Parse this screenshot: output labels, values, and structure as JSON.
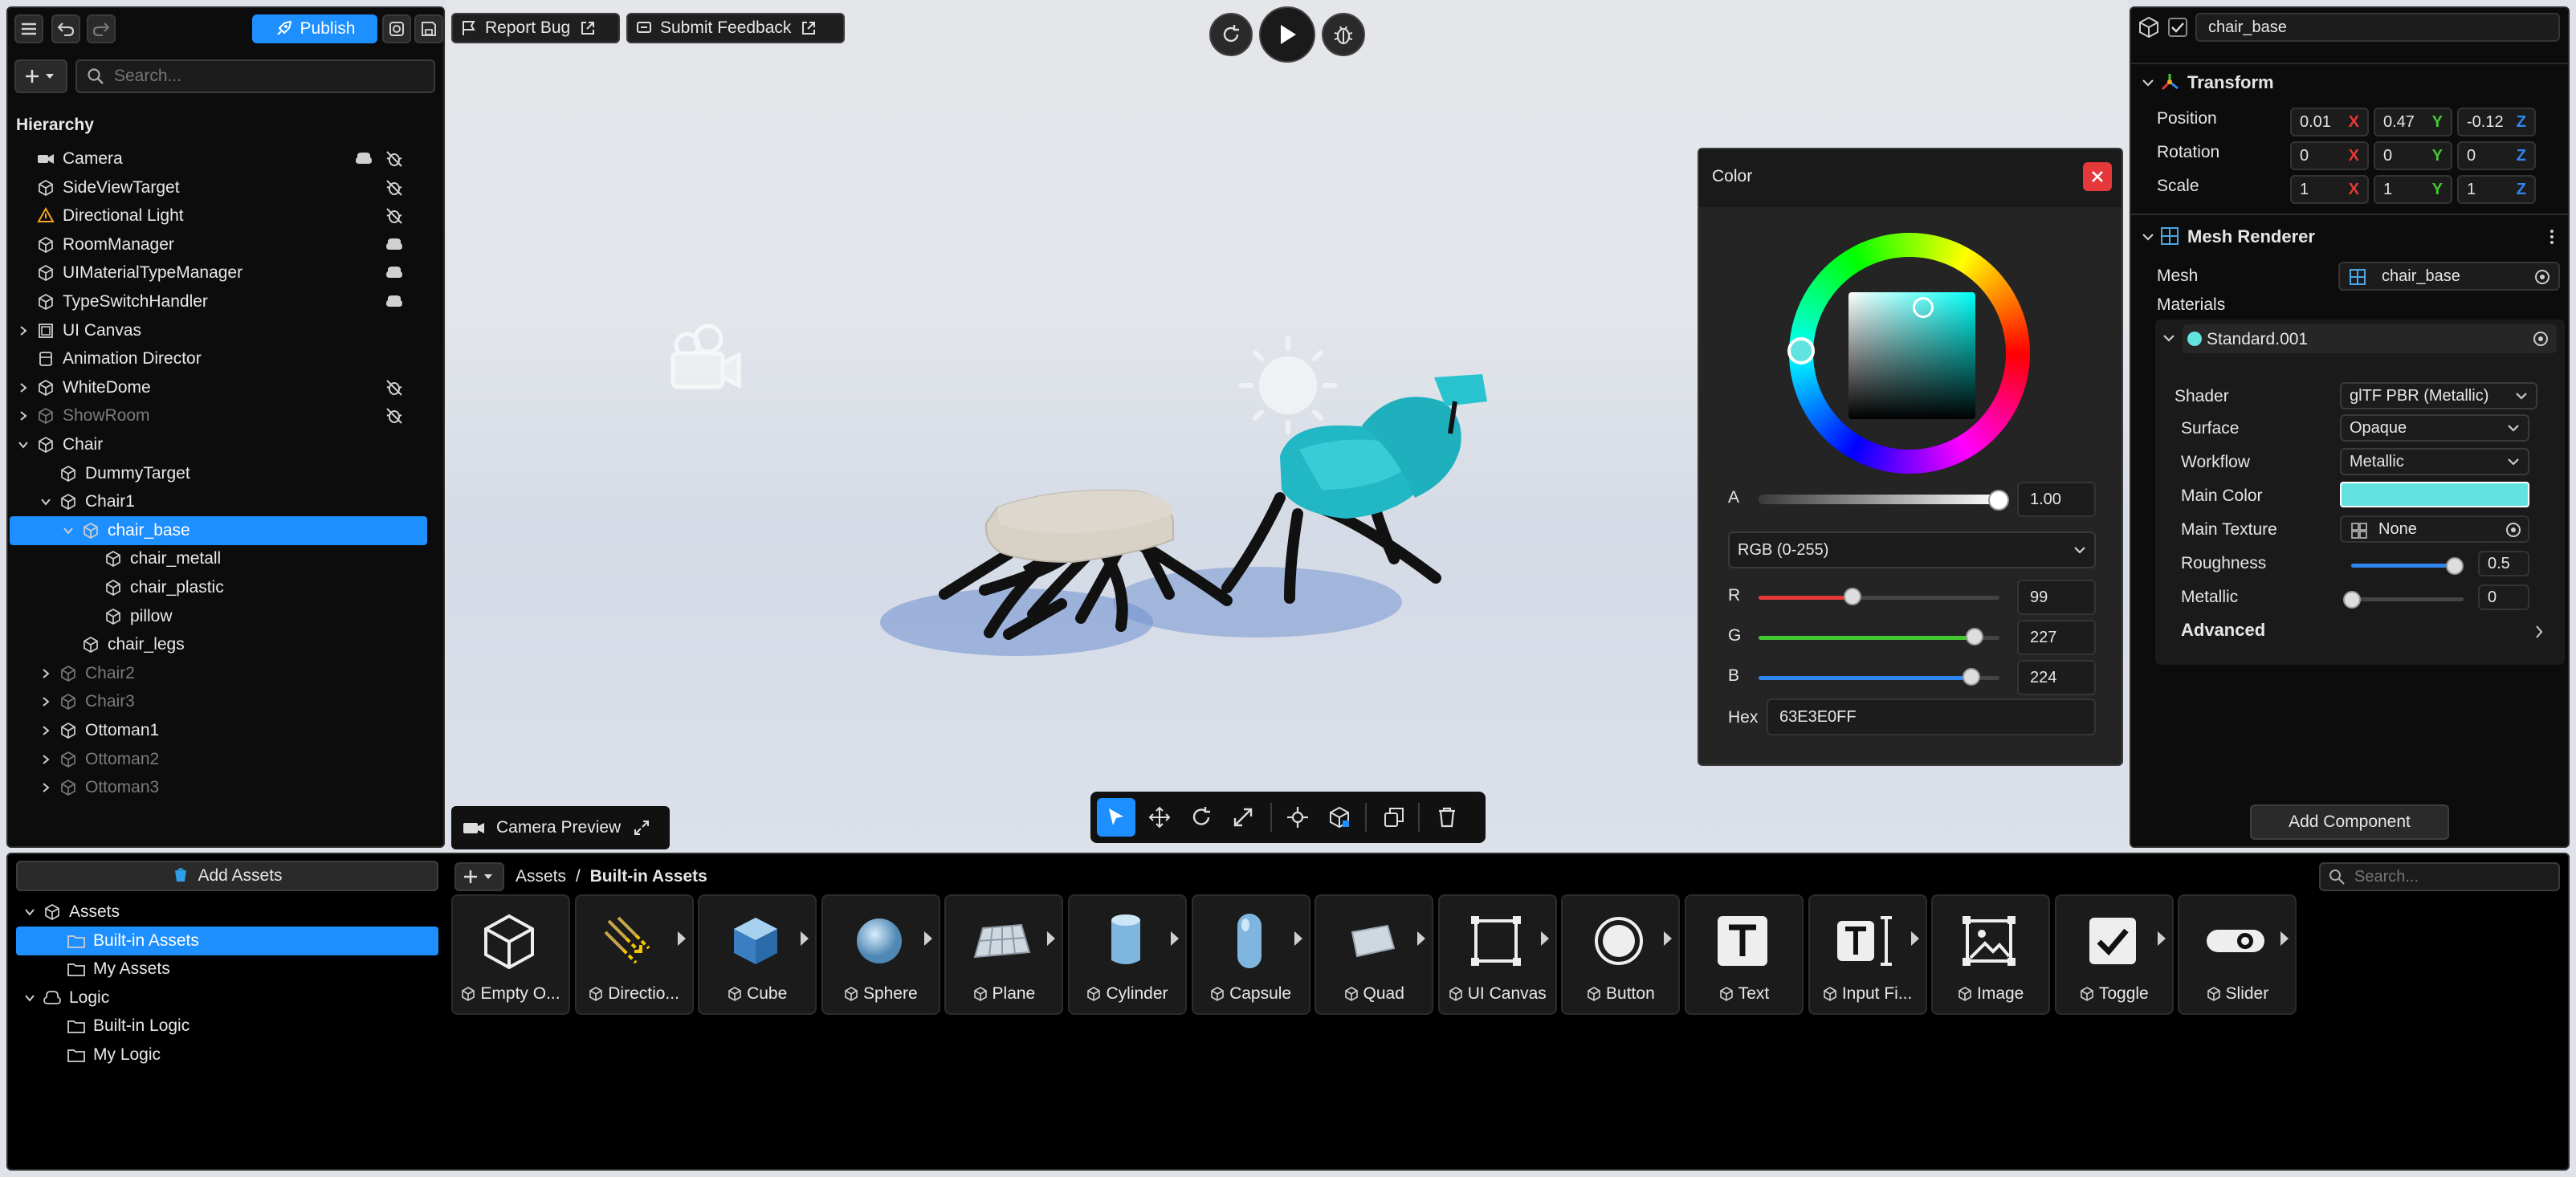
{
  "toolbar": {
    "publish_label": "Publish",
    "report_bug_label": "Report Bug",
    "submit_feedback_label": "Submit Feedback"
  },
  "hierarchy": {
    "search_placeholder": "Search...",
    "title": "Hierarchy",
    "items": [
      {
        "label": "Camera",
        "depth": 0,
        "expand": "none",
        "icon": "camera-icon",
        "dim": false,
        "badges": [
          "script-icon",
          "visibility-off-icon"
        ]
      },
      {
        "label": "SideViewTarget",
        "depth": 0,
        "expand": "none",
        "icon": "cube-icon",
        "dim": false,
        "badges": [
          "visibility-off-icon"
        ]
      },
      {
        "label": "Directional Light",
        "depth": 0,
        "expand": "none",
        "icon": "light-icon",
        "dim": false,
        "badges": [
          "visibility-off-icon"
        ]
      },
      {
        "label": "RoomManager",
        "depth": 0,
        "expand": "none",
        "icon": "cube-icon",
        "dim": false,
        "badges": [
          "script-icon"
        ]
      },
      {
        "label": "UIMaterialTypeManager",
        "depth": 0,
        "expand": "none",
        "icon": "cube-icon",
        "dim": false,
        "badges": [
          "script-icon"
        ]
      },
      {
        "label": "TypeSwitchHandler",
        "depth": 0,
        "expand": "none",
        "icon": "cube-icon",
        "dim": false,
        "badges": [
          "script-icon"
        ]
      },
      {
        "label": "UI Canvas",
        "depth": 0,
        "expand": "collapsed",
        "icon": "canvas-icon",
        "dim": false,
        "badges": []
      },
      {
        "label": "Animation Director",
        "depth": 0,
        "expand": "none",
        "icon": "animation-icon",
        "dim": false,
        "badges": []
      },
      {
        "label": "WhiteDome",
        "depth": 0,
        "expand": "collapsed",
        "icon": "cube-icon",
        "dim": false,
        "badges": [
          "visibility-off-icon"
        ]
      },
      {
        "label": "ShowRoom",
        "depth": 0,
        "expand": "collapsed",
        "icon": "cube-icon",
        "dim": true,
        "badges": [
          "visibility-off-icon"
        ]
      },
      {
        "label": "Chair",
        "depth": 0,
        "expand": "expanded",
        "icon": "cube-icon",
        "dim": false,
        "badges": []
      },
      {
        "label": "DummyTarget",
        "depth": 1,
        "expand": "none",
        "icon": "cube-icon",
        "dim": false,
        "badges": []
      },
      {
        "label": "Chair1",
        "depth": 1,
        "expand": "expanded",
        "icon": "cube-icon",
        "dim": false,
        "badges": []
      },
      {
        "label": "chair_base",
        "depth": 2,
        "expand": "expanded",
        "icon": "cube-icon",
        "dim": false,
        "badges": [],
        "selected": true
      },
      {
        "label": "chair_metall",
        "depth": 3,
        "expand": "none",
        "icon": "cube-icon",
        "dim": false,
        "badges": []
      },
      {
        "label": "chair_plastic",
        "depth": 3,
        "expand": "none",
        "icon": "cube-icon",
        "dim": false,
        "badges": []
      },
      {
        "label": "pillow",
        "depth": 3,
        "expand": "none",
        "icon": "cube-icon",
        "dim": false,
        "badges": []
      },
      {
        "label": "chair_legs",
        "depth": 2,
        "expand": "none",
        "icon": "cube-icon",
        "dim": false,
        "badges": []
      },
      {
        "label": "Chair2",
        "depth": 1,
        "expand": "collapsed",
        "icon": "cube-icon",
        "dim": true,
        "badges": []
      },
      {
        "label": "Chair3",
        "depth": 1,
        "expand": "collapsed",
        "icon": "cube-icon",
        "dim": true,
        "badges": []
      },
      {
        "label": "Ottoman1",
        "depth": 1,
        "expand": "collapsed",
        "icon": "cube-icon",
        "dim": false,
        "badges": []
      },
      {
        "label": "Ottoman2",
        "depth": 1,
        "expand": "collapsed",
        "icon": "cube-icon",
        "dim": true,
        "badges": []
      },
      {
        "label": "Ottoman3",
        "depth": 1,
        "expand": "collapsed",
        "icon": "cube-icon",
        "dim": true,
        "badges": []
      }
    ]
  },
  "viewport": {
    "camera_preview_label": "Camera Preview"
  },
  "color_picker": {
    "title": "Color",
    "alpha_label": "A",
    "alpha_value": "1.00",
    "mode_label": "RGB (0-255)",
    "r_label": "R",
    "r_value": "99",
    "g_label": "G",
    "g_value": "227",
    "b_label": "B",
    "b_value": "224",
    "hex_label": "Hex",
    "hex_value": "63E3E0FF",
    "color": "#63e3e0"
  },
  "inspector": {
    "object_name": "chair_base",
    "transform": {
      "title": "Transform",
      "position_label": "Position",
      "rotation_label": "Rotation",
      "scale_label": "Scale",
      "position": [
        "0.01",
        "0.47",
        "-0.12"
      ],
      "rotation": [
        "0",
        "0",
        "0"
      ],
      "scale": [
        "1",
        "1",
        "1"
      ],
      "axes": [
        "X",
        "Y",
        "Z"
      ]
    },
    "mesh_renderer": {
      "title": "Mesh Renderer",
      "mesh_label": "Mesh",
      "mesh_value": "chair_base",
      "materials_label": "Materials",
      "material_name": "Standard.001",
      "shader_label": "Shader",
      "shader_value": "glTF PBR (Metallic)",
      "surface_label": "Surface",
      "surface_value": "Opaque",
      "workflow_label": "Workflow",
      "workflow_value": "Metallic",
      "main_color_label": "Main Color",
      "main_texture_label": "Main Texture",
      "main_texture_value": "None",
      "roughness_label": "Roughness",
      "roughness_value": "0.5",
      "metallic_label": "Metallic",
      "metallic_value": "0",
      "advanced_label": "Advanced"
    },
    "add_component_label": "Add Component"
  },
  "assets_panel": {
    "add_assets_label": "Add Assets",
    "tree": [
      {
        "label": "Assets",
        "depth": 0,
        "expand": "expanded",
        "icon": "cube-icon"
      },
      {
        "label": "Built-in Assets",
        "depth": 1,
        "expand": "none",
        "icon": "folder-icon",
        "selected": true
      },
      {
        "label": "My Assets",
        "depth": 1,
        "expand": "none",
        "icon": "folder-icon"
      },
      {
        "label": "Logic",
        "depth": 0,
        "expand": "expanded",
        "icon": "logic-icon"
      },
      {
        "label": "Built-in Logic",
        "depth": 1,
        "expand": "none",
        "icon": "folder-icon"
      },
      {
        "label": "My Logic",
        "depth": 1,
        "expand": "none",
        "icon": "folder-icon"
      }
    ],
    "breadcrumb_root": "Assets",
    "breadcrumb_sep": "/",
    "breadcrumb_current": "Built-in Assets",
    "search_placeholder": "Search...",
    "items": [
      "Empty O...",
      "Directio...",
      "Cube",
      "Sphere",
      "Plane",
      "Cylinder",
      "Capsule",
      "Quad",
      "UI Canvas",
      "Button",
      "Text",
      "Input Fi...",
      "Image",
      "Toggle",
      "Slider"
    ]
  }
}
